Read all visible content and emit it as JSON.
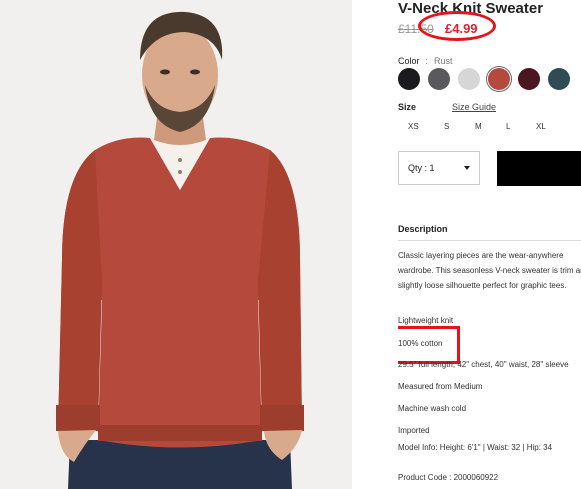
{
  "product": {
    "title": "V-Neck Knit Sweater",
    "price_original": "£11.50",
    "price_sale": "£4.99"
  },
  "color": {
    "label": "Color",
    "separator": ":",
    "selected": "Rust",
    "swatches": [
      {
        "name": "black",
        "color": "#1b1b1f"
      },
      {
        "name": "charcoal",
        "color": "#5a5a5e"
      },
      {
        "name": "heather-grey",
        "color": "#d6d6d6"
      },
      {
        "name": "rust",
        "color": "#b54a3c"
      },
      {
        "name": "burgundy",
        "color": "#4d1522"
      },
      {
        "name": "slate",
        "color": "#2f4b53"
      }
    ]
  },
  "size": {
    "label": "Size",
    "guide_label": "Size Guide",
    "options": [
      "XS",
      "S",
      "M",
      "L",
      "XL"
    ]
  },
  "quantity": {
    "label": "Qty : 1"
  },
  "description": {
    "heading": "Description",
    "text": "Classic layering pieces are the wear-anywhere wardrobe. This seasonless V-neck sweater is trim and a slightly loose silhouette perfect for graphic tees.",
    "features": [
      "Lightweight knit",
      "100% cotton",
      "29.5\" full length, 42\" chest, 40\" waist, 28\" sleeve",
      "Measured from Medium",
      "Machine wash cold",
      "Imported",
      "Model Info: Height: 6'1\" | Waist: 32 | Hip: 34"
    ],
    "product_code": "Product Code : 2000060922"
  },
  "annotations": {
    "highlight_color": "#e5141b"
  }
}
